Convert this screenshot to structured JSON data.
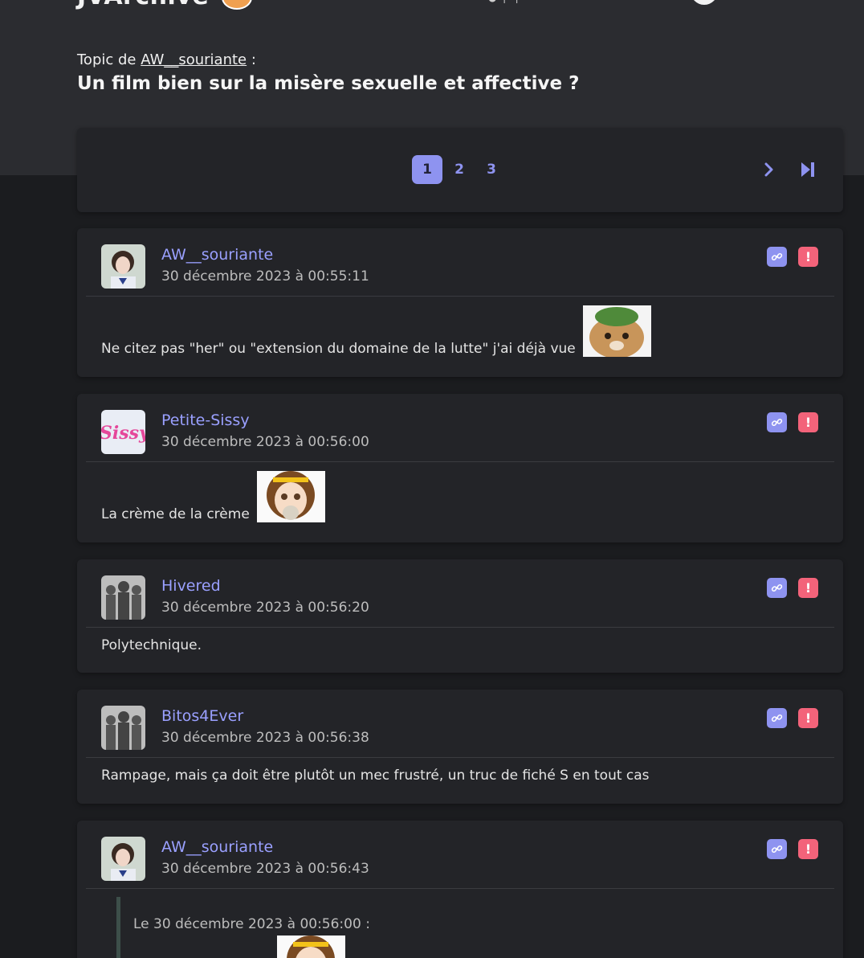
{
  "site": {
    "logo_text": "JVArchive"
  },
  "topic": {
    "by_prefix": "Topic de",
    "author": "AW__souriante",
    "by_suffix": " :",
    "title": "Un film bien sur la misère sexuelle et affective ?"
  },
  "pagination": {
    "pages": [
      "1",
      "2",
      "3"
    ],
    "current": "1"
  },
  "colors": {
    "accent": "#8e93f0",
    "report": "#f3637a",
    "hero_bg": "#2b2c30",
    "page_bg": "#1b1c1f",
    "card_bg": "#232428"
  },
  "posts": [
    {
      "author": "AW__souriante",
      "date": "30 décembre 2023 à 00:55:11",
      "text": "Ne citez pas \"her\" ou \"extension du domaine de la lutte\" j'ai déjà vue "
    },
    {
      "author": "Petite-Sissy",
      "date": "30 décembre 2023 à 00:56:00",
      "text": "La crème de la crème "
    },
    {
      "author": "Hivered",
      "date": "30 décembre 2023 à 00:56:20",
      "text": "Polytechnique."
    },
    {
      "author": "Bitos4Ever",
      "date": "30 décembre 2023 à 00:56:38",
      "text": "Rampage, mais ça doit être plutôt un mec frustré, un truc de fiché S en tout cas"
    },
    {
      "author": "AW__souriante",
      "date": "30 décembre 2023 à 00:56:43",
      "quote_header": "Le 30 décembre 2023 à 00:56:00 :"
    }
  ]
}
